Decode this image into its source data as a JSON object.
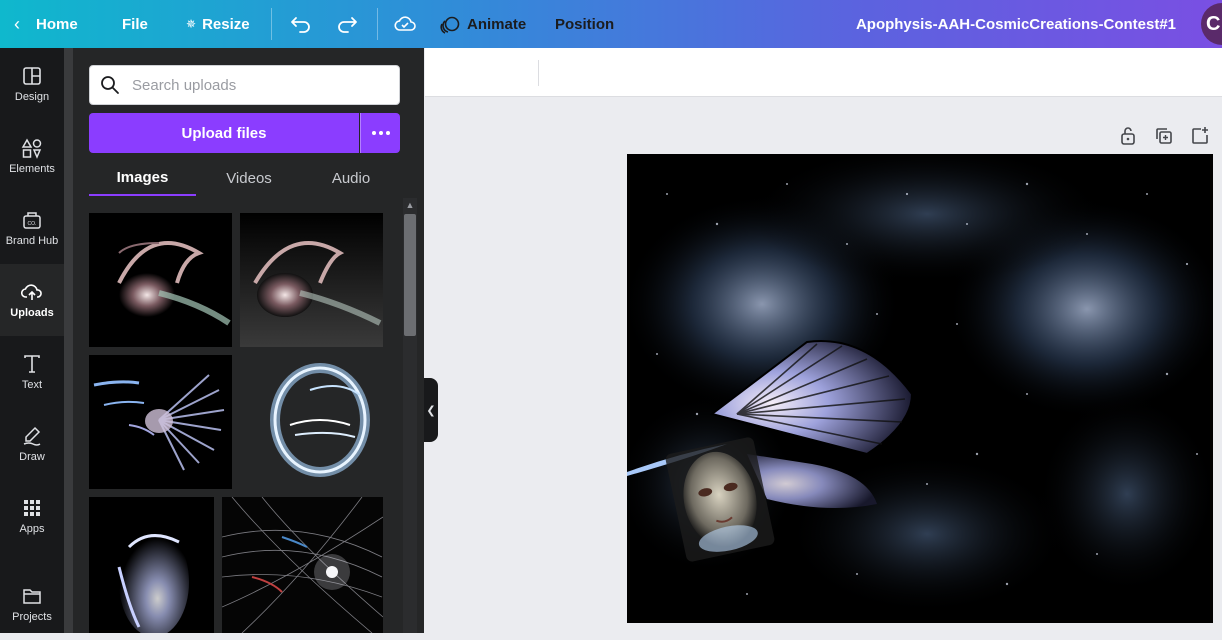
{
  "topbar": {
    "home_label": "Home",
    "file_label": "File",
    "resize_label": "Resize",
    "title": "Apophysis-AAH-CosmicCreations-Contest#1",
    "avatar_initial": "C"
  },
  "rail": {
    "items": [
      {
        "label": "Design",
        "icon": "layout-icon"
      },
      {
        "label": "Elements",
        "icon": "shapes-icon"
      },
      {
        "label": "Brand Hub",
        "icon": "brand-kit-icon"
      },
      {
        "label": "Uploads",
        "icon": "cloud-upload-icon"
      },
      {
        "label": "Text",
        "icon": "text-icon"
      },
      {
        "label": "Draw",
        "icon": "pen-icon"
      },
      {
        "label": "Apps",
        "icon": "grid-icon"
      },
      {
        "label": "Projects",
        "icon": "folder-icon"
      }
    ],
    "active": "Uploads"
  },
  "uploads": {
    "search_placeholder": "Search uploads",
    "upload_label": "Upload files",
    "tabs": [
      {
        "label": "Images"
      },
      {
        "label": "Videos"
      },
      {
        "label": "Audio"
      }
    ],
    "active_tab": "Images"
  },
  "context_toolbar": {
    "animate_label": "Animate",
    "position_label": "Position"
  },
  "colors": {
    "accent": "#8b3dff",
    "panel_bg": "#252627",
    "rail_bg": "#18191b"
  }
}
